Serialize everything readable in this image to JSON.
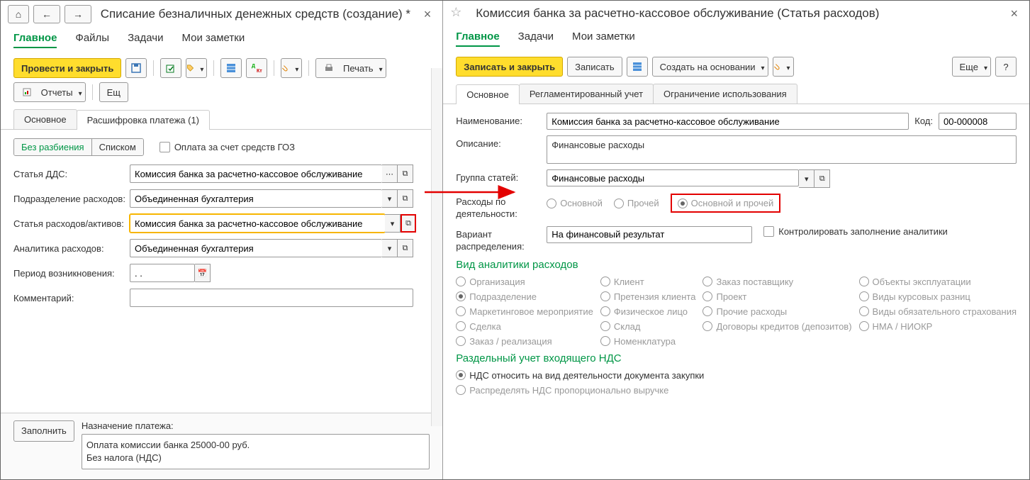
{
  "left": {
    "title": "Списание безналичных денежных средств (создание) *",
    "menu": {
      "main": "Главное",
      "files": "Файлы",
      "tasks": "Задачи",
      "notes": "Мои заметки"
    },
    "toolbar": {
      "post_close": "Провести и закрыть",
      "print": "Печать",
      "reports": "Отчеты",
      "more": "Ещ"
    },
    "tabs": {
      "main": "Основное",
      "detail": "Расшифровка платежа (1)"
    },
    "toggle": {
      "no_split": "Без разбиения",
      "list": "Списком"
    },
    "goz_cb": "Оплата за счет средств ГОЗ",
    "fields": {
      "dds_label": "Статья ДДС:",
      "dds_value": "Комиссия банка за расчетно-кассовое обслуживание",
      "dept_label": "Подразделение расходов:",
      "dept_value": "Объединенная бухгалтерия",
      "expense_label": "Статья расходов/активов:",
      "expense_value": "Комиссия банка за расчетно-кассовое обслуживание",
      "analytics_label": "Аналитика расходов:",
      "analytics_value": "Объединенная бухгалтерия",
      "period_label": "Период возникновения:",
      "period_value": ". .",
      "comment_label": "Комментарий:"
    },
    "bottom": {
      "fill": "Заполнить",
      "purpose_label": "Назначение платежа:",
      "purpose_text": "Оплата комиссии банка 25000-00 руб.\nБез налога (НДС)"
    }
  },
  "right": {
    "title": "Комиссия банка за расчетно-кассовое обслуживание (Статья расходов)",
    "menu": {
      "main": "Главное",
      "tasks": "Задачи",
      "notes": "Мои заметки"
    },
    "toolbar": {
      "save_close": "Записать и закрыть",
      "save": "Записать",
      "create_based": "Создать на основании",
      "more": "Еще",
      "help": "?"
    },
    "tabs": {
      "main": "Основное",
      "regl": "Регламентированный учет",
      "limit": "Ограничение использования"
    },
    "name_label": "Наименование:",
    "name_value": "Комиссия банка за расчетно-кассовое обслуживание",
    "code_label": "Код:",
    "code_value": "00-000008",
    "desc_label": "Описание:",
    "desc_value": "Финансовые расходы",
    "group_label": "Группа статей:",
    "group_value": "Финансовые расходы",
    "activity_label": "Расходы по деятельности:",
    "activity": {
      "main": "Основной",
      "other": "Прочей",
      "both": "Основной и прочей"
    },
    "variant_label": "Вариант распределения:",
    "variant_value": "На финансовый результат",
    "ctrl_cb": "Контролировать заполнение аналитики",
    "section_analytics": "Вид аналитики расходов",
    "analytics": {
      "org": "Организация",
      "client": "Клиент",
      "order_sup": "Заказ поставщику",
      "obj": "Объекты эксплуатации",
      "dept": "Подразделение",
      "claim": "Претензия клиента",
      "project": "Проект",
      "fx": "Виды курсовых разниц",
      "mkt": "Маркетинговое мероприятие",
      "person": "Физическое лицо",
      "other_exp": "Прочие расходы",
      "ins": "Виды обязательного страхования",
      "deal": "Сделка",
      "wh": "Склад",
      "credit": "Договоры кредитов (депозитов)",
      "nma": "НМА / НИОКР",
      "order_real": "Заказ / реализация",
      "nomen": "Номенклатура"
    },
    "section_vat": "Раздельный учет входящего НДС",
    "vat": {
      "by_doc": "НДС относить на вид деятельности документа закупки",
      "proportional": "Распределять НДС пропорционально выручке"
    }
  }
}
